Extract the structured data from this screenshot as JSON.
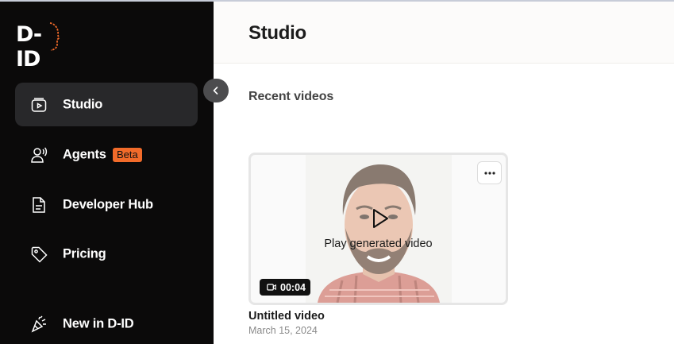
{
  "brand": {
    "logo_text": "D-ID",
    "accent": "#f26b2a"
  },
  "sidebar": {
    "items": [
      {
        "label": "Studio",
        "icon": "studio-icon",
        "active": true
      },
      {
        "label": "Agents",
        "icon": "agents-icon",
        "badge": "Beta"
      },
      {
        "label": "Developer Hub",
        "icon": "document-icon"
      },
      {
        "label": "Pricing",
        "icon": "tag-icon"
      },
      {
        "label": "New in D-ID",
        "icon": "party-popper-icon"
      }
    ],
    "collapse_icon": "chevron-left-icon"
  },
  "header": {
    "title": "Studio"
  },
  "main": {
    "section_title": "Recent videos",
    "videos": [
      {
        "title": "Untitled video",
        "date": "March 15, 2024",
        "duration": "00:04",
        "play_label": "Play generated video",
        "more_icon": "more-options-icon"
      }
    ]
  }
}
